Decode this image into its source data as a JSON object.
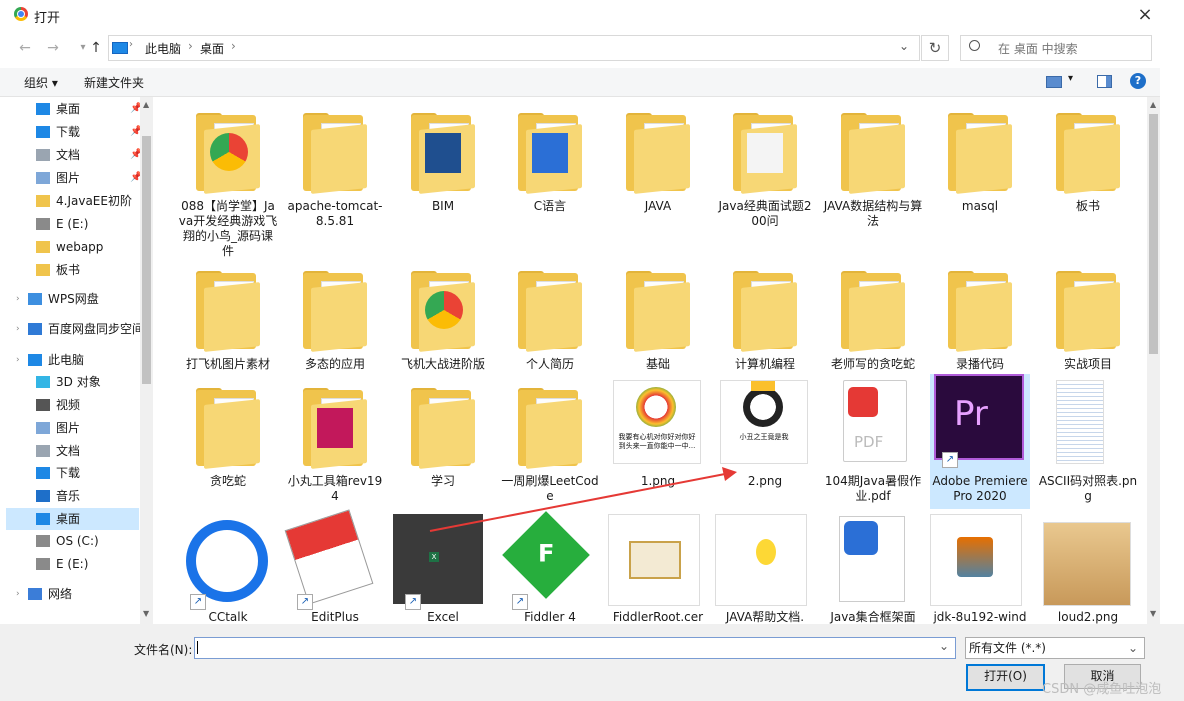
{
  "window": {
    "title": "打开",
    "close_icon": "×"
  },
  "nav": {
    "back_icon": "←",
    "forward_icon": "→",
    "up_icon": "↑",
    "breadcrumb": [
      "此电脑",
      "桌面"
    ],
    "search_placeholder": "在 桌面 中搜索"
  },
  "toolbar": {
    "organize": "组织 ▾",
    "new_folder": "新建文件夹"
  },
  "sidebar": {
    "items": [
      {
        "label": "桌面",
        "icon": "desktop-icon",
        "pinned": true
      },
      {
        "label": "下载",
        "icon": "download-icon",
        "pinned": true
      },
      {
        "label": "文档",
        "icon": "document-icon",
        "pinned": true
      },
      {
        "label": "图片",
        "icon": "pictures-icon",
        "pinned": true
      },
      {
        "label": "4.JavaEE初阶",
        "icon": "folder-icon"
      },
      {
        "label": "E (E:)",
        "icon": "drive-icon"
      },
      {
        "label": "webapp",
        "icon": "folder-icon"
      },
      {
        "label": "板书",
        "icon": "folder-icon"
      },
      {
        "label": "WPS网盘",
        "icon": "cloud-icon"
      },
      {
        "label": "百度网盘同步空间",
        "icon": "baidu-icon"
      },
      {
        "label": "此电脑",
        "icon": "computer-icon"
      },
      {
        "label": "3D 对象",
        "icon": "3d-icon"
      },
      {
        "label": "视频",
        "icon": "video-icon"
      },
      {
        "label": "图片",
        "icon": "pictures-icon"
      },
      {
        "label": "文档",
        "icon": "document-icon"
      },
      {
        "label": "下载",
        "icon": "download-icon"
      },
      {
        "label": "音乐",
        "icon": "music-icon"
      },
      {
        "label": "桌面",
        "icon": "desktop-icon",
        "selected": true
      },
      {
        "label": "OS (C:)",
        "icon": "drive-icon"
      },
      {
        "label": "E (E:)",
        "icon": "drive-icon"
      },
      {
        "label": "网络",
        "icon": "network-icon"
      }
    ]
  },
  "files": [
    {
      "name": "088【尚学堂】Java开发经典游戏飞翔的小鸟_源码课件",
      "kind": "folder",
      "badge": "chrome"
    },
    {
      "name": "apache-tomcat-8.5.81",
      "kind": "folder"
    },
    {
      "name": "BIM",
      "kind": "folder",
      "badge": "rfa"
    },
    {
      "name": "C语言",
      "kind": "folder",
      "badge": "word"
    },
    {
      "name": "JAVA",
      "kind": "folder"
    },
    {
      "name": "Java经典面试题200问",
      "kind": "folder",
      "badge": "pdf"
    },
    {
      "name": "JAVA数据结构与算法",
      "kind": "folder"
    },
    {
      "name": "masql",
      "kind": "folder"
    },
    {
      "name": "板书",
      "kind": "folder"
    },
    {
      "name": "打飞机图片素材",
      "kind": "folder"
    },
    {
      "name": "多态的应用",
      "kind": "folder"
    },
    {
      "name": "飞机大战进阶版",
      "kind": "folder",
      "badge": "chrome"
    },
    {
      "name": "个人简历",
      "kind": "folder"
    },
    {
      "name": "基础",
      "kind": "folder"
    },
    {
      "name": "计算机编程",
      "kind": "folder"
    },
    {
      "name": "老师写的贪吃蛇",
      "kind": "folder"
    },
    {
      "name": "录播代码",
      "kind": "folder"
    },
    {
      "name": "实战项目",
      "kind": "folder"
    },
    {
      "name": "贪吃蛇",
      "kind": "folder"
    },
    {
      "name": "小丸工具箱rev194",
      "kind": "folder",
      "badge": "pink"
    },
    {
      "name": "学习",
      "kind": "folder"
    },
    {
      "name": "一周刷爆LeetCode",
      "kind": "folder"
    },
    {
      "name": "1.png",
      "kind": "image",
      "badge": "clown"
    },
    {
      "name": "2.png",
      "kind": "image",
      "badge": "clown2"
    },
    {
      "name": "104期Java暑假作业.pdf",
      "kind": "pdf"
    },
    {
      "name": "Adobe Premiere Pro 2020",
      "kind": "premiere",
      "selected": true
    },
    {
      "name": "ASCII码对照表.png",
      "kind": "image",
      "badge": "table"
    },
    {
      "name": "CCtalk",
      "kind": "cctalk"
    },
    {
      "name": "EditPlus",
      "kind": "editplus"
    },
    {
      "name": "Excel",
      "kind": "excel"
    },
    {
      "name": "Fiddler 4",
      "kind": "fiddler"
    },
    {
      "name": "FiddlerRoot.cer",
      "kind": "cert"
    },
    {
      "name": "JAVA帮助文档.",
      "kind": "help"
    },
    {
      "name": "Java集合框架面",
      "kind": "word"
    },
    {
      "name": "jdk-8u192-wind",
      "kind": "jdk"
    },
    {
      "name": "loud2.png",
      "kind": "image",
      "badge": "doge"
    }
  ],
  "clown_captions": {
    "one": "我要有心机对你好对你好到头来一直你能中一中...",
    "two": "小丑之王竟是我"
  },
  "pdf_label": "PDF",
  "premiere_label": "Pr",
  "fiddler_label": "F",
  "excel_label": "X",
  "shortcut_arrow": "↗",
  "bottom": {
    "filename_label": "文件名(N):",
    "filename_value": "",
    "filetype": "所有文件 (*.*)",
    "open": "打开(O)",
    "cancel": "取消"
  },
  "watermark": "CSDN @咸鱼吐泡泡",
  "colors": {
    "accent": "#0078d7",
    "selection": "#cce8ff",
    "folder": "#f0c44c",
    "arrow": "#e53935"
  }
}
